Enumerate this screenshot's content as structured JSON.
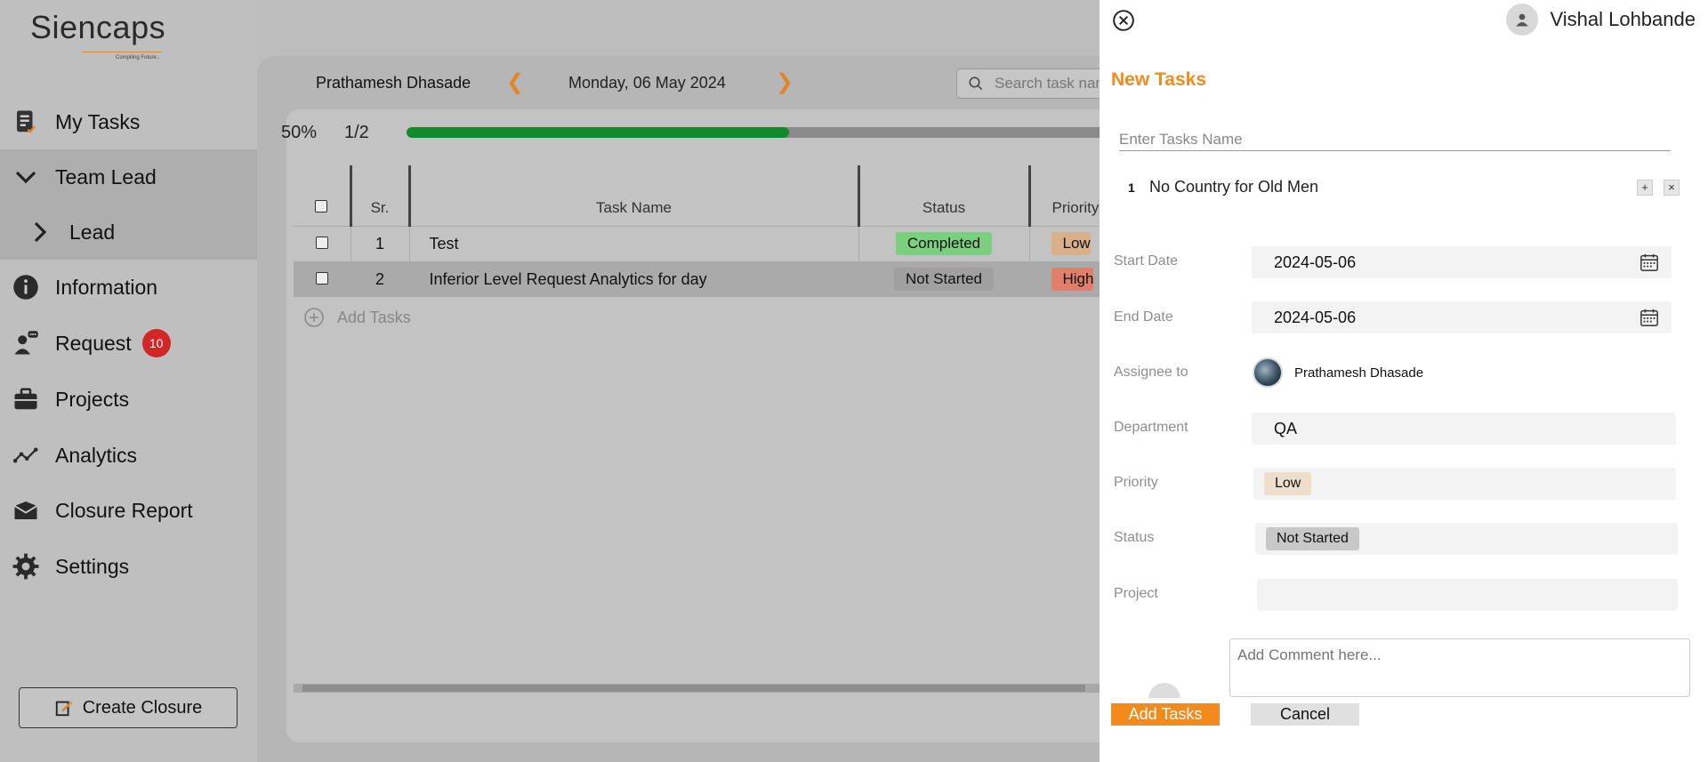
{
  "app": {
    "logo_text": "Siencaps",
    "logo_tagline": "Compiling Future..."
  },
  "sidebar": {
    "items": [
      {
        "label": "My Tasks",
        "icon": "task-list-icon"
      },
      {
        "label": "Team Lead",
        "icon": "chevron-down-icon"
      },
      {
        "label": "Lead",
        "icon": "chevron-right-icon"
      },
      {
        "label": "Information",
        "icon": "info-icon"
      },
      {
        "label": "Request",
        "icon": "request-icon",
        "badge": "10"
      },
      {
        "label": "Projects",
        "icon": "briefcase-icon"
      },
      {
        "label": "Analytics",
        "icon": "analytics-icon"
      },
      {
        "label": "Closure Report",
        "icon": "closure-report-icon"
      },
      {
        "label": "Settings",
        "icon": "gear-icon"
      }
    ],
    "create_button": "Create Closure"
  },
  "main": {
    "user_name": "Prathamesh Dhasade",
    "date": "Monday, 06 May 2024",
    "search_placeholder": "Search task name",
    "progress": {
      "percent_label": "50%",
      "fraction_label": "1/2",
      "value": 0.5
    },
    "table": {
      "headers": {
        "sr": "Sr.",
        "name": "Task Name",
        "status": "Status",
        "priority": "Priority"
      },
      "rows": [
        {
          "sr": "1",
          "name": "Test",
          "status": "Completed",
          "priority": "Low"
        },
        {
          "sr": "2",
          "name": "Inferior Level Request Analytics for day",
          "status": "Not Started",
          "priority": "High"
        }
      ]
    },
    "add_tasks": "Add Tasks"
  },
  "drawer": {
    "user": "Vishal Lohbande",
    "title": "New Tasks",
    "name_placeholder": "Enter Tasks Name",
    "task_item": {
      "num": "1",
      "label": "No Country for Old Men"
    },
    "fields": {
      "start_date": {
        "label": "Start Date",
        "value": "2024-05-06"
      },
      "end_date": {
        "label": "End Date",
        "value": "2024-05-06"
      },
      "assignee": {
        "label": "Assignee to",
        "value": "Prathamesh Dhasade"
      },
      "department": {
        "label": "Department",
        "value": "QA"
      },
      "priority": {
        "label": "Priority",
        "value": "Low"
      },
      "status": {
        "label": "Status",
        "value": "Not Started"
      },
      "project": {
        "label": "Project",
        "value": ""
      }
    },
    "comment_placeholder": "Add Comment here...",
    "add_button": "Add Tasks",
    "cancel_button": "Cancel"
  },
  "colors": {
    "accent": "#f28a1c",
    "progress": "#118a2e",
    "completed": "#7ccf7e",
    "not_started": "#a0a0a0",
    "low": "#d9b08a",
    "high": "#e07f6a",
    "badge": "#d32626"
  }
}
